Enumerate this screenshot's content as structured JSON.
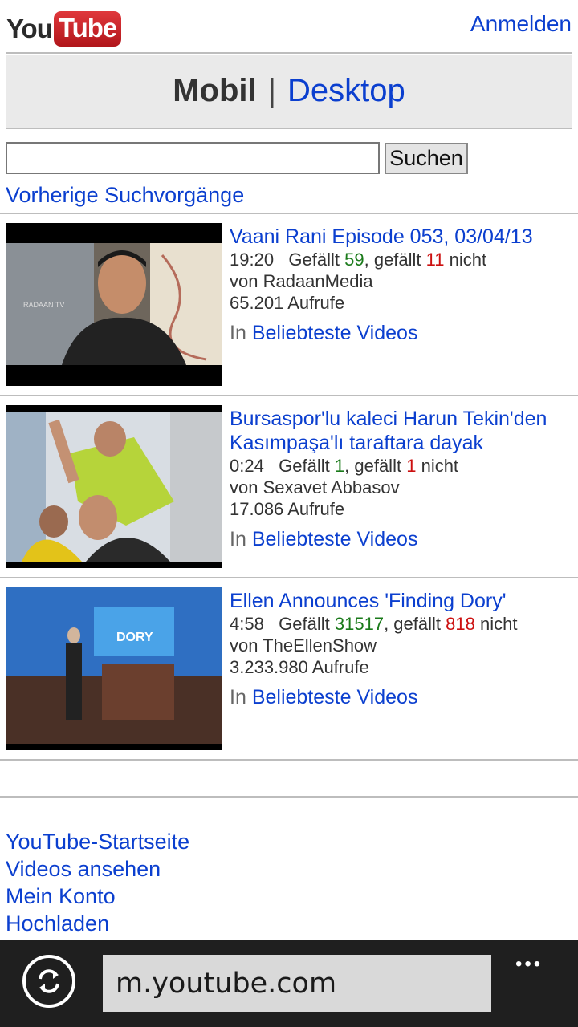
{
  "header": {
    "logo_you": "You",
    "logo_tube": "Tube",
    "signin": "Anmelden"
  },
  "mode": {
    "mobile": "Mobil",
    "separator": "|",
    "desktop": "Desktop"
  },
  "search": {
    "value": "",
    "button": "Suchen",
    "previous": "Vorherige Suchvorgänge"
  },
  "videos": [
    {
      "title": "Vaani Rani Episode 053, 03/04/13",
      "duration": "19:20",
      "likes_label": "Gefällt",
      "likes": "59",
      "dislikes_prefix": ", gefällt",
      "dislikes": "11",
      "dislikes_suffix": "nicht",
      "author": "von RadaanMedia",
      "views": "65.201 Aufrufe",
      "in_label": "In",
      "category": "Beliebteste Videos"
    },
    {
      "title": "Bursaspor'lu kaleci Harun Tekin'den Kasımpaşa'lı taraftara dayak",
      "duration": "0:24",
      "likes_label": "Gefällt",
      "likes": "1",
      "dislikes_prefix": ", gefällt",
      "dislikes": "1",
      "dislikes_suffix": "nicht",
      "author": "von Sexavet Abbasov",
      "views": "17.086 Aufrufe",
      "in_label": "In",
      "category": "Beliebteste Videos"
    },
    {
      "title": "Ellen Announces 'Finding Dory'",
      "duration": "4:58",
      "likes_label": "Gefällt",
      "likes": "31517",
      "dislikes_prefix": ", gefällt",
      "dislikes": "818",
      "dislikes_suffix": "nicht",
      "author": "von TheEllenShow",
      "views": "3.233.980 Aufrufe",
      "in_label": "In",
      "category": "Beliebteste Videos"
    }
  ],
  "footer": {
    "links": [
      "YouTube-Startseite",
      "Videos ansehen",
      "Mein Konto",
      "Hochladen"
    ]
  },
  "browser": {
    "url": "m.youtube.com",
    "menu": "•••"
  },
  "colors": {
    "link": "#0b3fcf",
    "likes": "#1a7a1a",
    "dislikes": "#cc1010",
    "browser_bar": "#1f1f1f"
  }
}
